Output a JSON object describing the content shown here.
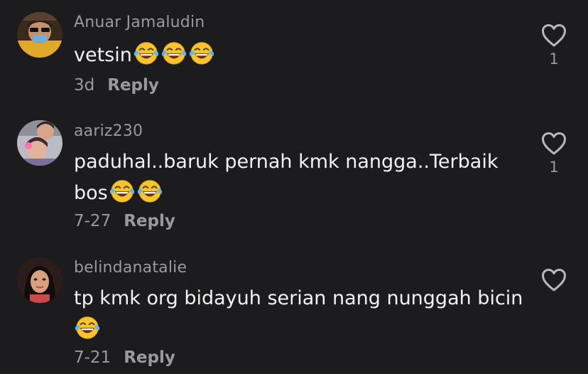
{
  "comments": [
    {
      "username": "Anuar Jamaludin",
      "text_line1": "vetsin",
      "text_line2": "",
      "time": "3d",
      "reply_label": "Reply",
      "likes": "1",
      "avatar": "avatar-man-with-sunglasses"
    },
    {
      "username": "aariz230",
      "text_line1": "paduhal..baruk pernah kmk nangga..Terbaik",
      "text_line2": "bos",
      "time": "7-27",
      "reply_label": "Reply",
      "likes": "1",
      "avatar": "avatar-child-selfie"
    },
    {
      "username": "belindanatalie",
      "text_line1": "tp kmk org bidayuh serian nang nunggah bicin",
      "text_line2": "",
      "time": "7-21",
      "reply_label": "Reply",
      "likes": "",
      "avatar": "avatar-woman-portrait"
    }
  ],
  "colors": {
    "background": "#1c1c1e",
    "text_primary": "#f2f2f2",
    "text_secondary": "#9a9a9e",
    "heart_stroke": "#b8b8bc",
    "emoji_face": "#f7c52b"
  },
  "icons": {
    "like": "heart-outline-icon",
    "emoji": "face-with-tears-of-joy-emoji"
  }
}
